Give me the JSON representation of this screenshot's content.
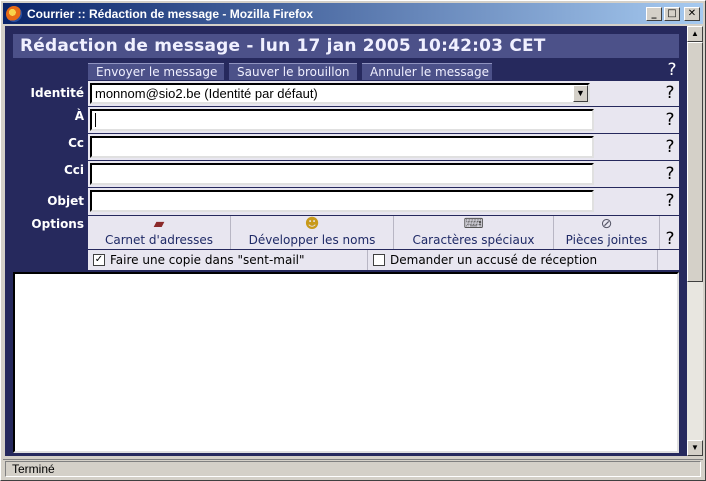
{
  "window": {
    "title": "Courrier :: Rédaction de message - Mozilla Firefox",
    "minimize": "_",
    "maximize": "□",
    "close": "✕"
  },
  "header": {
    "title": "Rédaction de message - lun 17 jan 2005 10:42:03 CET"
  },
  "actions": {
    "send": "Envoyer le message",
    "save_draft": "Sauver le brouillon",
    "cancel": "Annuler le message"
  },
  "help_glyph": "?",
  "form": {
    "identity_label": "Identité",
    "identity_value": "monnom@sio2.be (Identité par défaut)",
    "to_label": "À",
    "to_value": "",
    "cc_label": "Cc",
    "cc_value": "",
    "bcc_label": "Cci",
    "bcc_value": "",
    "subject_label": "Objet",
    "subject_value": "",
    "options_label": "Options"
  },
  "options": {
    "address_book": "Carnet d'adresses",
    "expand_names": "Développer les noms",
    "special_chars": "Caractères spéciaux",
    "attachments": "Pièces jointes"
  },
  "checks": {
    "copy_sent": "Faire une copie dans \"sent-mail\"",
    "copy_sent_checked": true,
    "read_receipt": "Demander un accusé de réception",
    "read_receipt_checked": false
  },
  "message_body": "",
  "status": {
    "text": "Terminé"
  },
  "icons": {
    "address_book": "book-icon",
    "expand_names": "people-search-icon",
    "special_chars": "keyboard-icon",
    "attachments": "paperclip-icon"
  },
  "colors": {
    "page_bg": "#26295d",
    "header_bg": "#4c5189",
    "form_row_bg": "#e8e6f0"
  }
}
